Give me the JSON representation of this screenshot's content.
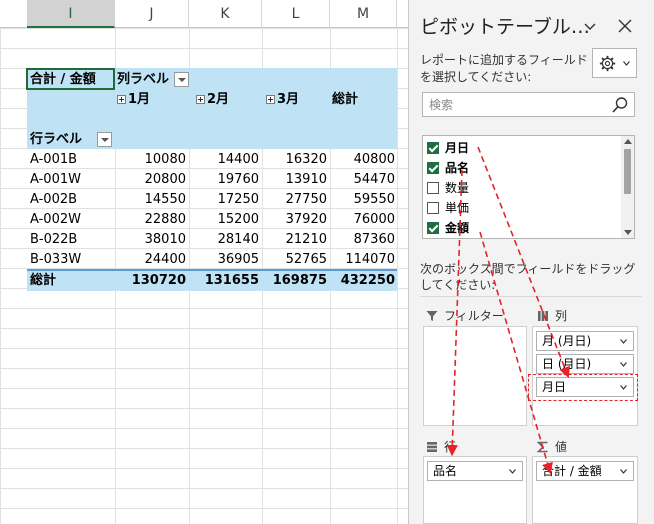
{
  "sheet": {
    "columns": [
      {
        "label": "I",
        "selected": true
      },
      {
        "label": "J",
        "selected": false
      },
      {
        "label": "K",
        "selected": false
      },
      {
        "label": "L",
        "selected": false
      },
      {
        "label": "M",
        "selected": false
      }
    ],
    "pivot": {
      "value_header": "合計 / 金額",
      "column_label_header": "列ラベル",
      "months": [
        "1月",
        "2月",
        "3月"
      ],
      "grand_total_col": "総計",
      "row_label_header": "行ラベル",
      "rows": [
        {
          "label": "A-001B",
          "values": [
            "10080",
            "14400",
            "16320",
            "40800"
          ]
        },
        {
          "label": "A-001W",
          "values": [
            "20800",
            "19760",
            "13910",
            "54470"
          ]
        },
        {
          "label": "A-002B",
          "values": [
            "14550",
            "17250",
            "27750",
            "59550"
          ]
        },
        {
          "label": "A-002W",
          "values": [
            "22880",
            "15200",
            "37920",
            "76000"
          ]
        },
        {
          "label": "B-022B",
          "values": [
            "38010",
            "28140",
            "21210",
            "87360"
          ]
        },
        {
          "label": "B-033W",
          "values": [
            "24400",
            "36905",
            "52765",
            "114070"
          ]
        }
      ],
      "total_row": {
        "label": "総計",
        "values": [
          "130720",
          "131655",
          "169875",
          "432250"
        ]
      }
    }
  },
  "panel": {
    "title": "ピボットテーブル…",
    "description": "レポートに追加するフィールドを選択してください:",
    "search_placeholder": "検索",
    "fields": [
      {
        "label": "月日",
        "checked": true
      },
      {
        "label": "品名",
        "checked": true
      },
      {
        "label": "数量",
        "checked": false
      },
      {
        "label": "単価",
        "checked": false
      },
      {
        "label": "金額",
        "checked": true
      }
    ],
    "drag_description": "次のボックス間でフィールドをドラッグしてください:",
    "areas": {
      "filter": {
        "label": "フィルター",
        "items": []
      },
      "columns": {
        "label": "列",
        "items": [
          "月 (月日)",
          "日 (月日)",
          "月日"
        ]
      },
      "rows": {
        "label": "行",
        "items": [
          "品名"
        ]
      },
      "values": {
        "label": "値",
        "items": [
          "合計 / 金額"
        ]
      }
    },
    "icons": {
      "chevron": "chevron-down-icon",
      "close": "close-icon",
      "gear": "gear-icon",
      "search": "search-icon",
      "filter": "filter-icon",
      "columns": "columns-icon",
      "rows": "rows-icon",
      "values": "sigma-icon"
    },
    "accent_color": "#1f6e43",
    "annotation_color": "#e2242b"
  }
}
